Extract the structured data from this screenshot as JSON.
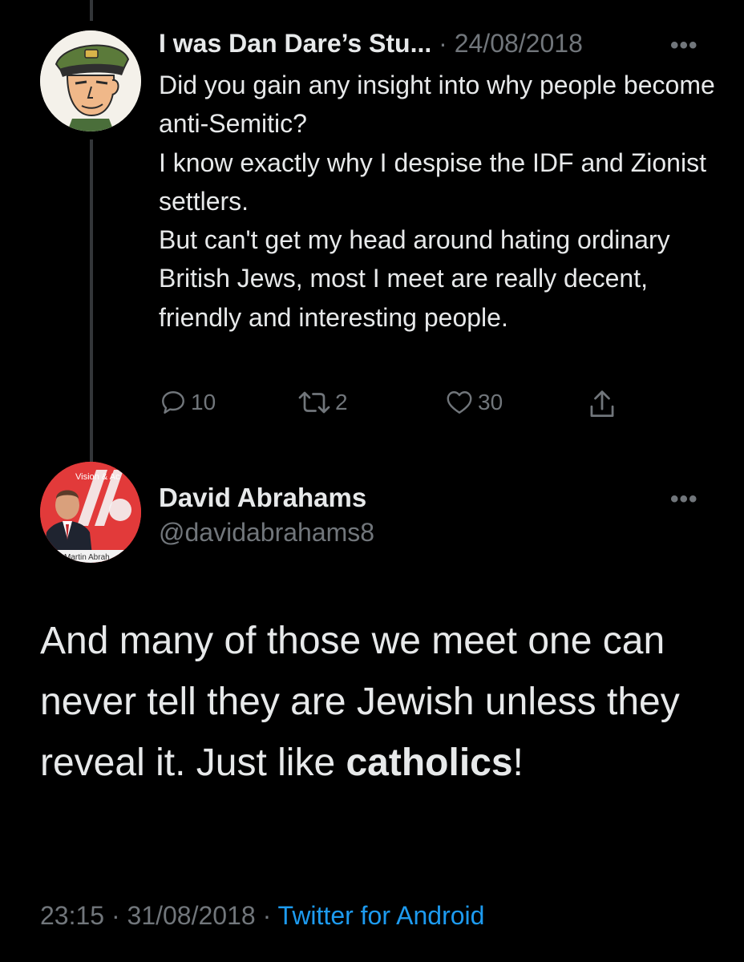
{
  "reply_tweet": {
    "display_name": "I was Dan Dare’s Stu...",
    "separator": "·",
    "date": "24/08/2018",
    "more_label": "•••",
    "lines": [
      "Did you gain any insight into why people become anti-Semitic?",
      "I know exactly why I despise the IDF and Zionist settlers.",
      "But can't get my head around hating ordinary British Jews, most I meet are really decent, friendly and interesting people."
    ],
    "reply_count": "10",
    "retweet_count": "2",
    "like_count": "30",
    "avatar_icon": "cartoon-pilot-avatar"
  },
  "main_tweet": {
    "display_name": "David Abrahams",
    "handle": "@davidabrahams8",
    "more_label": "•••",
    "avatar_banner_text": "Vision & Ac",
    "avatar_caption_text": "Martin Abrah",
    "text_plain": "And many of those we meet one can never tell they are Jewish unless they reveal it. Just like ",
    "text_bold": "catholics",
    "text_end": "!",
    "time": "23:15",
    "separator": "·",
    "date": "31/08/2018",
    "source": "Twitter for Android"
  },
  "colors": {
    "background": "#000000",
    "primary_text": "#e7e9ea",
    "secondary_text": "#71767b",
    "link": "#1d9bf0"
  }
}
